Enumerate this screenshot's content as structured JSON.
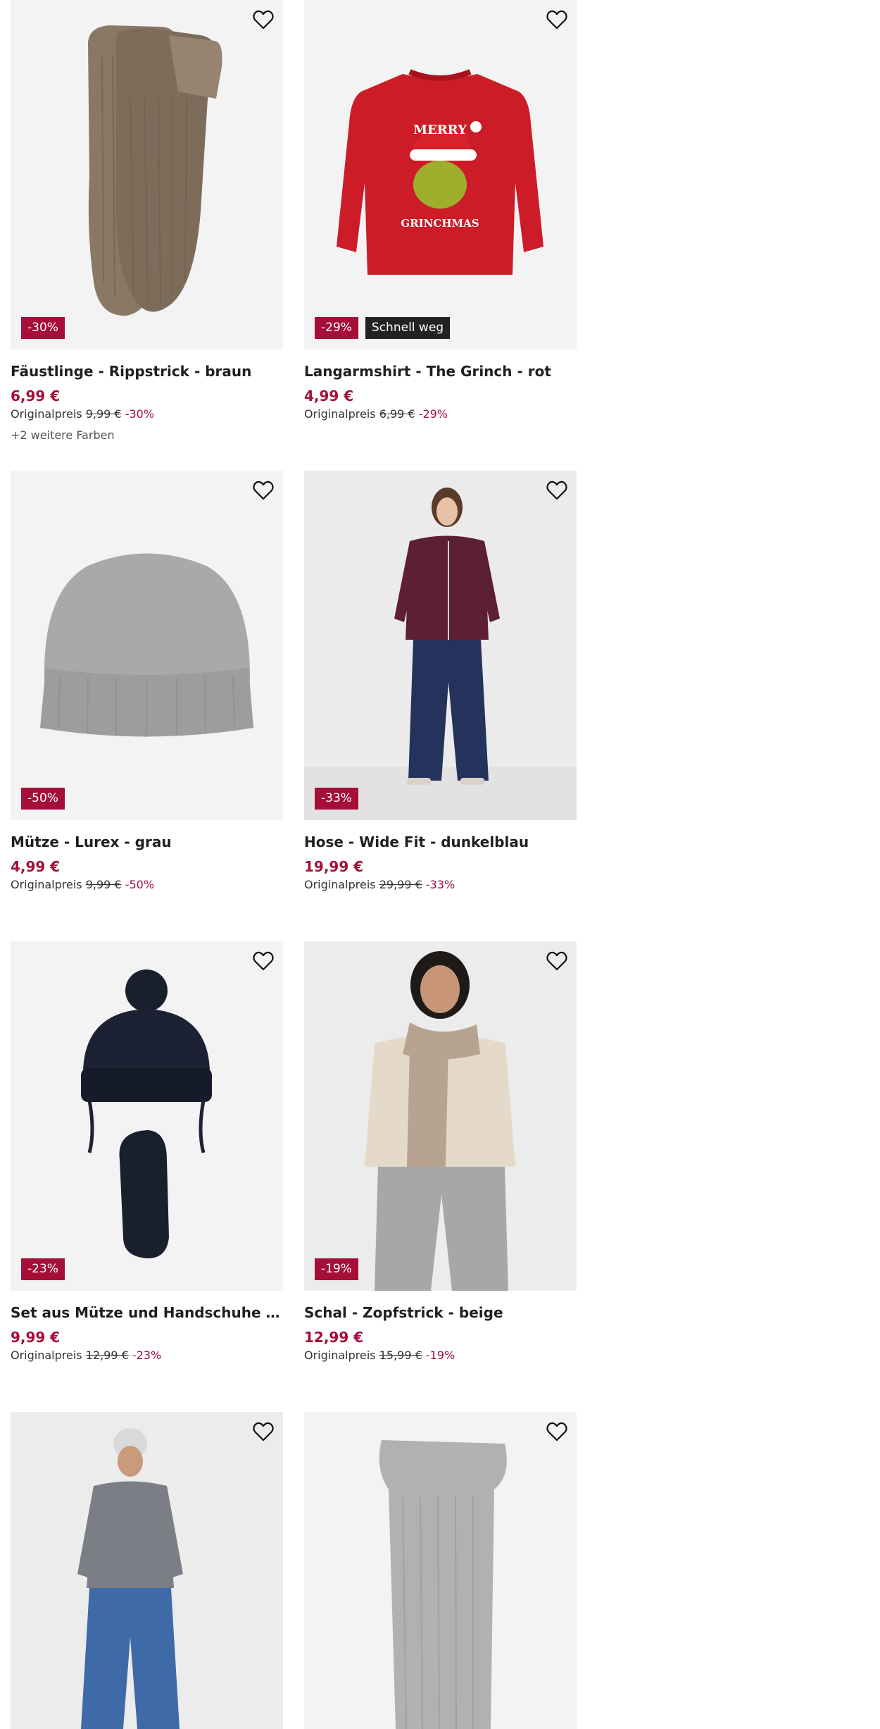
{
  "products": [
    {
      "title": "Fäustlinge - Rippstrick - braun",
      "price": "6,99 €",
      "orig_label": "Originalpreis",
      "orig_price": "9,99 €",
      "discount": "-30%",
      "badge": "-30%",
      "extra": "+2 weitere Farben"
    },
    {
      "title": "Langarmshirt - The Grinch - rot",
      "price": "4,99 €",
      "orig_label": "Originalpreis",
      "orig_price": "6,99 €",
      "discount": "-29%",
      "badge": "-29%",
      "badge2": "Schnell weg",
      "print_line1": "MERRY",
      "print_line2": "GRINCHMAS"
    },
    {
      "title": "Mütze - Lurex - grau",
      "price": "4,99 €",
      "orig_label": "Originalpreis",
      "orig_price": "9,99 €",
      "discount": "-50%",
      "badge": "-50%"
    },
    {
      "title": "Hose - Wide Fit - dunkelblau",
      "price": "19,99 €",
      "orig_label": "Originalpreis",
      "orig_price": "29,99 €",
      "discount": "-33%",
      "badge": "-33%"
    },
    {
      "title": "Set aus Mütze und Handschuhe - Fleecef...",
      "price": "9,99 €",
      "orig_label": "Originalpreis",
      "orig_price": "12,99 €",
      "discount": "-23%",
      "badge": "-23%"
    },
    {
      "title": "Schal - Zopfstrick - beige",
      "price": "12,99 €",
      "orig_label": "Originalpreis",
      "orig_price": "15,99 €",
      "discount": "-19%",
      "badge": "-19%"
    },
    {
      "title": "",
      "price": ""
    },
    {
      "title": "",
      "price": ""
    }
  ],
  "colors": {
    "sale_red": "#a50e38",
    "badge_dark": "#222222",
    "image_bg": "#f3f3f4"
  },
  "icons": {
    "favorite": "heart-outline-icon"
  }
}
